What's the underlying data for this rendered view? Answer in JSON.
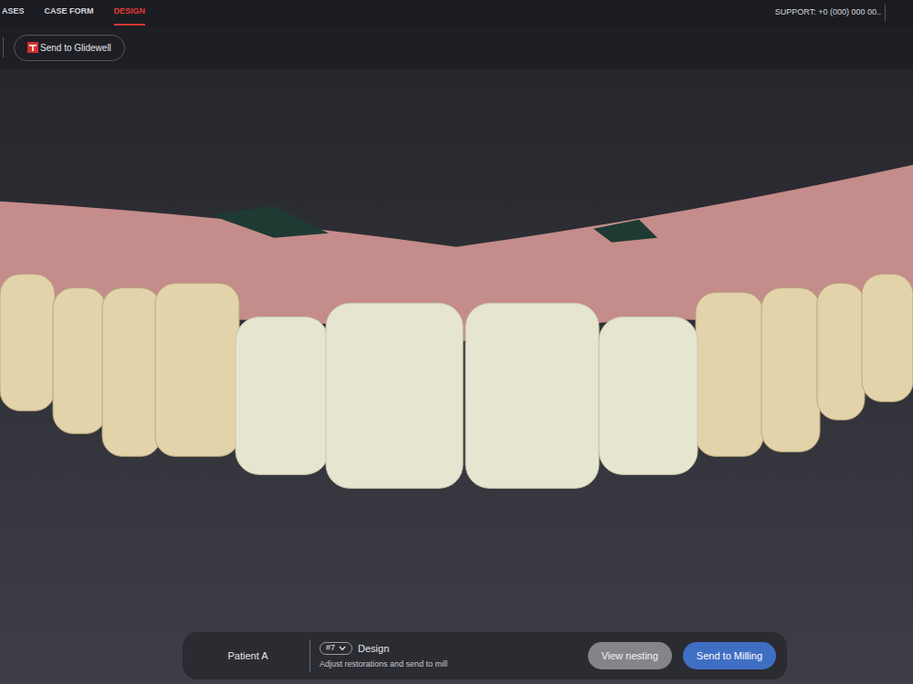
{
  "nav": {
    "tabs": [
      {
        "label": "ASES",
        "selected": false
      },
      {
        "label": "CASE FORM",
        "selected": false
      },
      {
        "label": "DESIGN",
        "selected": true
      }
    ],
    "support": "SUPPORT: +0 (000) 000 00.."
  },
  "toolbar": {
    "buttons": [
      "Send to Glidewell"
    ]
  },
  "bottom_bar": {
    "patient": "Patient A",
    "tooth": "#7",
    "step": "Design",
    "hint": "Adjust restorations and send to mill",
    "buttons": [
      {
        "label": "View nesting",
        "kind": "secondary"
      },
      {
        "label": "Send to Milling",
        "kind": "primary"
      }
    ]
  }
}
